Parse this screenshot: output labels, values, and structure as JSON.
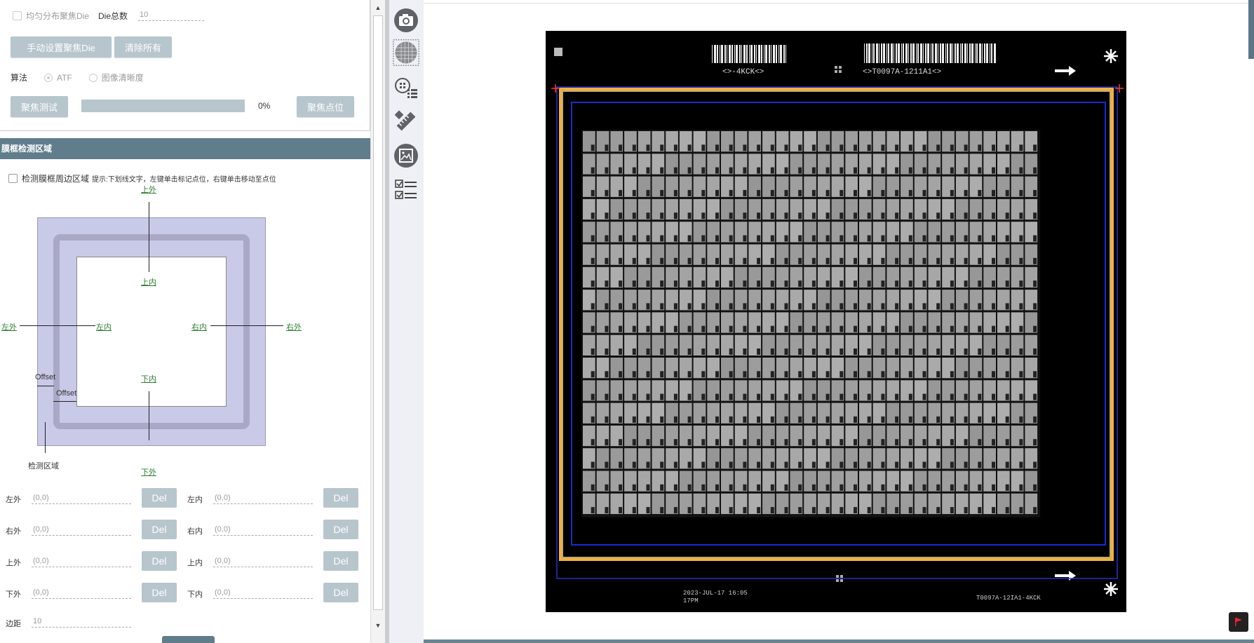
{
  "focus": {
    "uniform_checkbox_label": "均匀分布聚焦Die",
    "die_total_label": "Die总数",
    "die_total_value": "10",
    "manual_set_button": "手动设置聚焦Die",
    "clear_all_button": "清除所有",
    "algorithm_label": "算法",
    "algo_atf": "ATF",
    "algo_sharpness": "图像清晰度",
    "focus_test_button": "聚焦测试",
    "progress_percent": "0%",
    "progress_value": 0,
    "focus_point_button": "聚焦点位"
  },
  "frame_section": {
    "title": "膜框检测区域",
    "detect_checkbox_label": "检测膜框周边区域",
    "hint": "提示:下划线文字，左键单击标记点位，右键单击移动至点位"
  },
  "diagram": {
    "top_outer": "上外",
    "top_inner": "上内",
    "left_outer": "左外",
    "left_inner": "左内",
    "right_inner": "右内",
    "right_outer": "右外",
    "bottom_inner": "下内",
    "bottom_outer": "下外",
    "offset1": "Offset",
    "offset2": "Offset",
    "detect_area": "检测区域",
    "colors": {
      "outer_area": "#c9c9e8",
      "ring": "#a9a9c6",
      "link": "#2e7d32"
    }
  },
  "points": [
    {
      "label": "左外",
      "value": "(0,0)",
      "del": "Del"
    },
    {
      "label": "左内",
      "value": "(0,0)",
      "del": "Del"
    },
    {
      "label": "右外",
      "value": "(0,0)",
      "del": "Del"
    },
    {
      "label": "右内",
      "value": "(0,0)",
      "del": "Del"
    },
    {
      "label": "上外",
      "value": "(0,0)",
      "del": "Del"
    },
    {
      "label": "上内",
      "value": "(0,0)",
      "del": "Del"
    },
    {
      "label": "下外",
      "value": "(0,0)",
      "del": "Del"
    },
    {
      "label": "下内",
      "value": "(0,0)",
      "del": "Del"
    }
  ],
  "margin": {
    "label": "边距",
    "value": "10"
  },
  "toolbar_icons": [
    "camera-icon",
    "wafer-map-icon",
    "die-list-icon",
    "measure-icon",
    "image-frame-icon",
    "checklist-icon"
  ],
  "wafer": {
    "top_code_left": "<>-4KCK<>",
    "top_code_right": "<>T0097A-1211A1<>",
    "bottom_date": "2023-JUL-17 16:05",
    "bottom_id": "T0097A-12IA1-4KCK",
    "bottom_small": "17PM"
  }
}
